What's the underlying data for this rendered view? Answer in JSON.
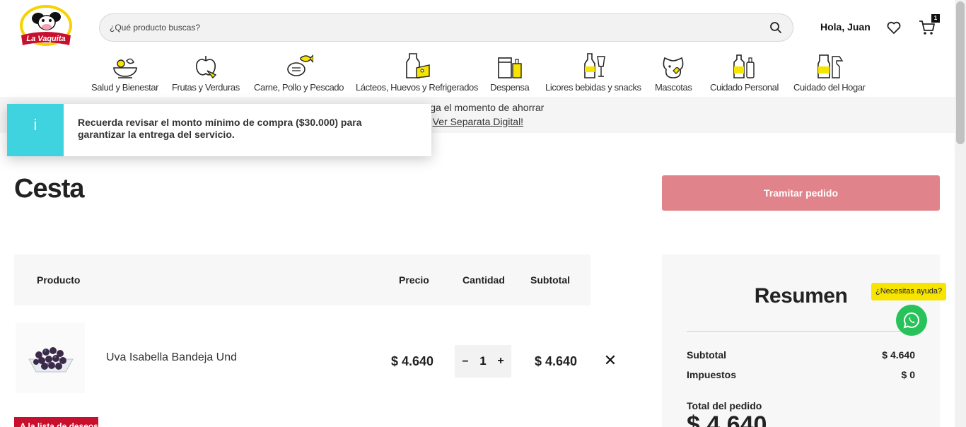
{
  "header": {
    "logo_text": "La Vaquita",
    "search_placeholder": "¿Qué producto buscas?",
    "greeting": "Hola, Juan",
    "cart_count": "1"
  },
  "categories": [
    {
      "label": "Salud y Bienestar",
      "icon": "salad-bowl-icon"
    },
    {
      "label": "Frutas y Verduras",
      "icon": "apple-basket-icon"
    },
    {
      "label": "Carne, Pollo y Pescado",
      "icon": "meat-fish-icon"
    },
    {
      "label": "Lácteos, Huevos y Refrigerados",
      "icon": "milk-cheese-icon"
    },
    {
      "label": "Despensa",
      "icon": "pantry-icon"
    },
    {
      "label": "Licores bebidas y snacks",
      "icon": "bottle-glass-icon"
    },
    {
      "label": "Mascotas",
      "icon": "pet-icon"
    },
    {
      "label": "Cuidado Personal",
      "icon": "personal-care-icon"
    },
    {
      "label": "Cuidado del Hogar",
      "icon": "home-care-icon"
    }
  ],
  "promo": {
    "text": "o, ya llega el momento de ahorrar",
    "link": "¡Ver Separata Digital!"
  },
  "toast": {
    "icon": "i",
    "message": "Recuerda revisar el monto mínimo de compra ($30.000) para garantizar la entrega del servicio."
  },
  "cart": {
    "title": "Cesta",
    "checkout_button": "Tramitar pedido",
    "columns": {
      "product": "Producto",
      "price": "Precio",
      "quantity": "Cantidad",
      "subtotal": "Subtotal"
    },
    "items": [
      {
        "name": "Uva Isabella Bandeja Und",
        "price": "$ 4.640",
        "quantity": "1",
        "subtotal": "$ 4.640",
        "remove": "✕"
      }
    ],
    "wishlist_button": "A la lista de deseos"
  },
  "summary": {
    "title": "Resumen",
    "subtotal_label": "Subtotal",
    "subtotal_value": "$ 4.640",
    "taxes_label": "Impuestos",
    "taxes_value": "$ 0",
    "total_label": "Total del pedido",
    "total_value": "$ 4.640"
  },
  "help": {
    "tooltip": "¿Necesitas ayuda?"
  },
  "colors": {
    "brand_red": "#c8102e",
    "checkout_disabled": "#e0838a",
    "info_cyan": "#3fd3e0",
    "icon_yellow": "#f7e400",
    "whatsapp_green": "#27c25a"
  }
}
